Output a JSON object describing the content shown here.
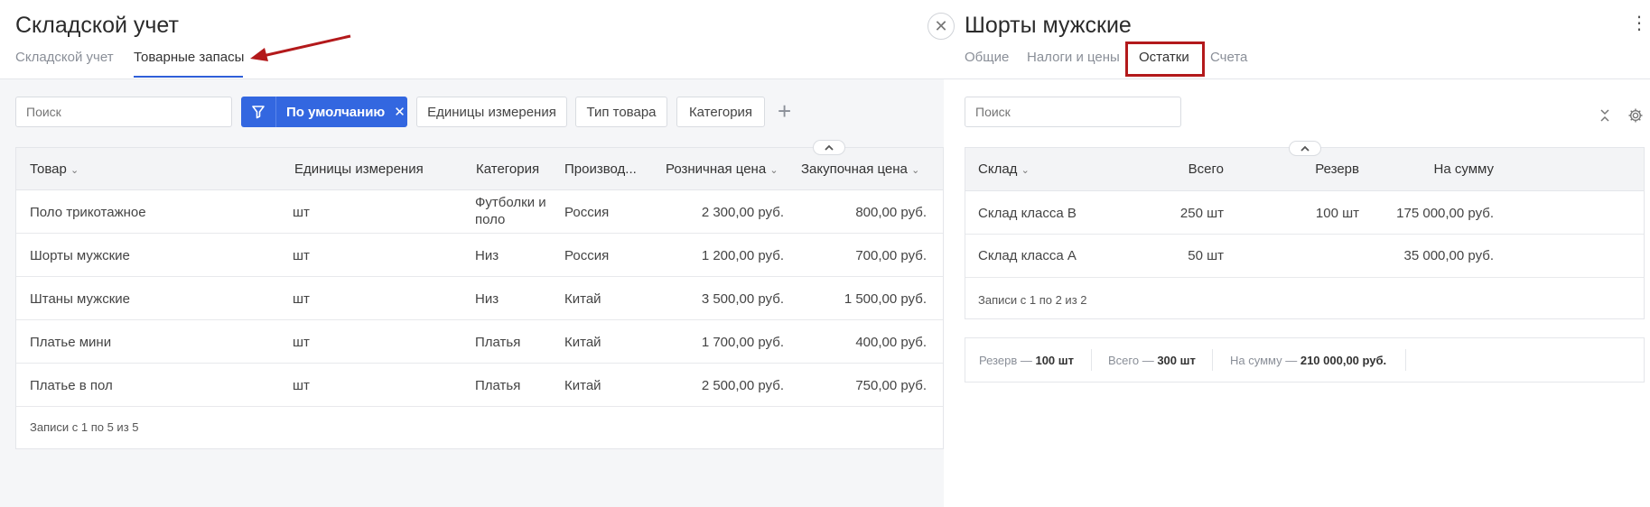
{
  "left": {
    "title": "Складской учет",
    "tabs": [
      "Складской учет",
      "Товарные запасы"
    ],
    "search_placeholder": "Поиск",
    "filter_label": "По умолчанию",
    "filter_chips": [
      "Единицы измерения",
      "Тип товара",
      "Категория"
    ],
    "columns": [
      "Товар",
      "Единицы измерения",
      "Категория",
      "Производ...",
      "Розничная цена",
      "Закупочная цена"
    ],
    "rows": [
      {
        "name": "Поло трикотажное",
        "unit": "шт",
        "category_line1": "Футболки и",
        "category_line2": "поло",
        "country": "Россия",
        "retail": "2 300,00 руб.",
        "purchase": "800,00 руб."
      },
      {
        "name": "Шорты мужские",
        "unit": "шт",
        "category_line1": "Низ",
        "category_line2": "",
        "country": "Россия",
        "retail": "1 200,00 руб.",
        "purchase": "700,00 руб."
      },
      {
        "name": "Штаны мужские",
        "unit": "шт",
        "category_line1": "Низ",
        "category_line2": "",
        "country": "Китай",
        "retail": "3 500,00 руб.",
        "purchase": "1 500,00 руб."
      },
      {
        "name": "Платье мини",
        "unit": "шт",
        "category_line1": "Платья",
        "category_line2": "",
        "country": "Китай",
        "retail": "1 700,00 руб.",
        "purchase": "400,00 руб."
      },
      {
        "name": "Платье в пол",
        "unit": "шт",
        "category_line1": "Платья",
        "category_line2": "",
        "country": "Китай",
        "retail": "2 500,00 руб.",
        "purchase": "750,00 руб."
      }
    ],
    "footer": "Записи с 1 по 5 из 5"
  },
  "right": {
    "title": "Шорты мужские",
    "tabs": [
      "Общие",
      "Налоги и цены",
      "Остатки",
      "Счета"
    ],
    "search_placeholder": "Поиск",
    "columns": [
      "Склад",
      "Всего",
      "Резерв",
      "На сумму"
    ],
    "rows": [
      {
        "warehouse": "Склад класса В",
        "total": "250 шт",
        "reserve": "100 шт",
        "sum": "175 000,00 руб."
      },
      {
        "warehouse": "Склад класса А",
        "total": "50 шт",
        "reserve": "",
        "sum": "35 000,00 руб."
      }
    ],
    "footer": "Записи с 1 по 2 из 2",
    "summary": {
      "reserve_label": "Резерв —",
      "reserve_value": "100 шт",
      "total_label": "Всего —",
      "total_value": "300 шт",
      "sum_label": "На сумму —",
      "sum_value": "210 000,00 руб."
    }
  },
  "colors": {
    "accent": "#3367e0",
    "annotation": "#b3191b"
  }
}
